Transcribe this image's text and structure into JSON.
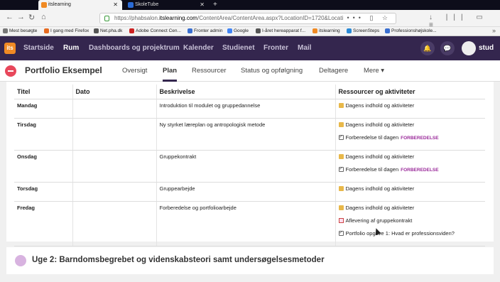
{
  "browser": {
    "tabs": [
      {
        "title": "itslearning",
        "active": true
      },
      {
        "title": "SkoleTube",
        "active": false
      }
    ],
    "url_prefix": "https://phabsalon.",
    "url_domain": "itslearning.com",
    "url_rest": "/ContentArea/ContentArea.aspx?LocationID=1720&Locati",
    "bookmarks": [
      "Mest besøgte",
      "I gang med Firefox",
      "Net.pha.dk",
      "Adobe Connect Cen...",
      "Fronter admin",
      "Google",
      "I-året hereapparat f...",
      "itslearning",
      "ScreenSteps",
      "Professionshøjskole..."
    ]
  },
  "app": {
    "logo": "its",
    "nav": [
      "Startside",
      "Rum",
      "Dashboards og projektrum",
      "Kalender",
      "Studienet",
      "Fronter",
      "Mail"
    ],
    "active_nav": "Rum",
    "user": "stud"
  },
  "course": {
    "title": "Portfolio Eksempel",
    "tabs": [
      "Oversigt",
      "Plan",
      "Ressourcer",
      "Status og opfølgning",
      "Deltagere",
      "Mere ▾"
    ],
    "active_tab": "Plan"
  },
  "table": {
    "headers": [
      "Titel",
      "Dato",
      "Beskrivelse",
      "Ressourcer og aktiviteter"
    ],
    "rows": [
      {
        "title": "Mandag",
        "date": "",
        "desc": "Introduktion til modulet og gruppedannelse",
        "resources": [
          {
            "icon": "folder-icon",
            "text": "Dagens indhold og aktiviteter",
            "tag": ""
          }
        ]
      },
      {
        "title": "Tirsdag",
        "date": "",
        "desc": "Ny styrket læreplan og antropologisk metode",
        "resources": [
          {
            "icon": "folder-icon",
            "text": "Dagens indhold og aktiviteter",
            "tag": ""
          },
          {
            "icon": "check-icon",
            "text": "Forberedelse til dagen",
            "tag": "FORBEREDELSE"
          }
        ]
      },
      {
        "title": "Onsdag",
        "date": "",
        "desc": "Gruppekontrakt",
        "resources": [
          {
            "icon": "folder-icon",
            "text": "Dagens indhold og aktiviteter",
            "tag": ""
          },
          {
            "icon": "check-icon",
            "text": "Forberedelse til dagen",
            "tag": "FORBEREDELSE"
          }
        ]
      },
      {
        "title": "Torsdag",
        "date": "",
        "desc": "Gruppearbejde",
        "resources": [
          {
            "icon": "folder-icon",
            "text": "Dagens indhold og aktiviteter",
            "tag": ""
          }
        ]
      },
      {
        "title": "Fredag",
        "date": "",
        "desc": "Forberedelse og portfolioarbejde",
        "resources": [
          {
            "icon": "folder-icon",
            "text": "Dagens indhold og aktiviteter",
            "tag": ""
          },
          {
            "icon": "doc-icon",
            "text": "Aflevering af gruppekontrakt",
            "tag": ""
          },
          {
            "icon": "check-icon",
            "text": "Portfolio opgave 1: Hvad er professionsviden?",
            "tag": ""
          }
        ]
      }
    ]
  },
  "week2": {
    "title": "Uge 2: Barndomsbegrebet og videnskabsteori samt undersøgelsesmetoder"
  }
}
